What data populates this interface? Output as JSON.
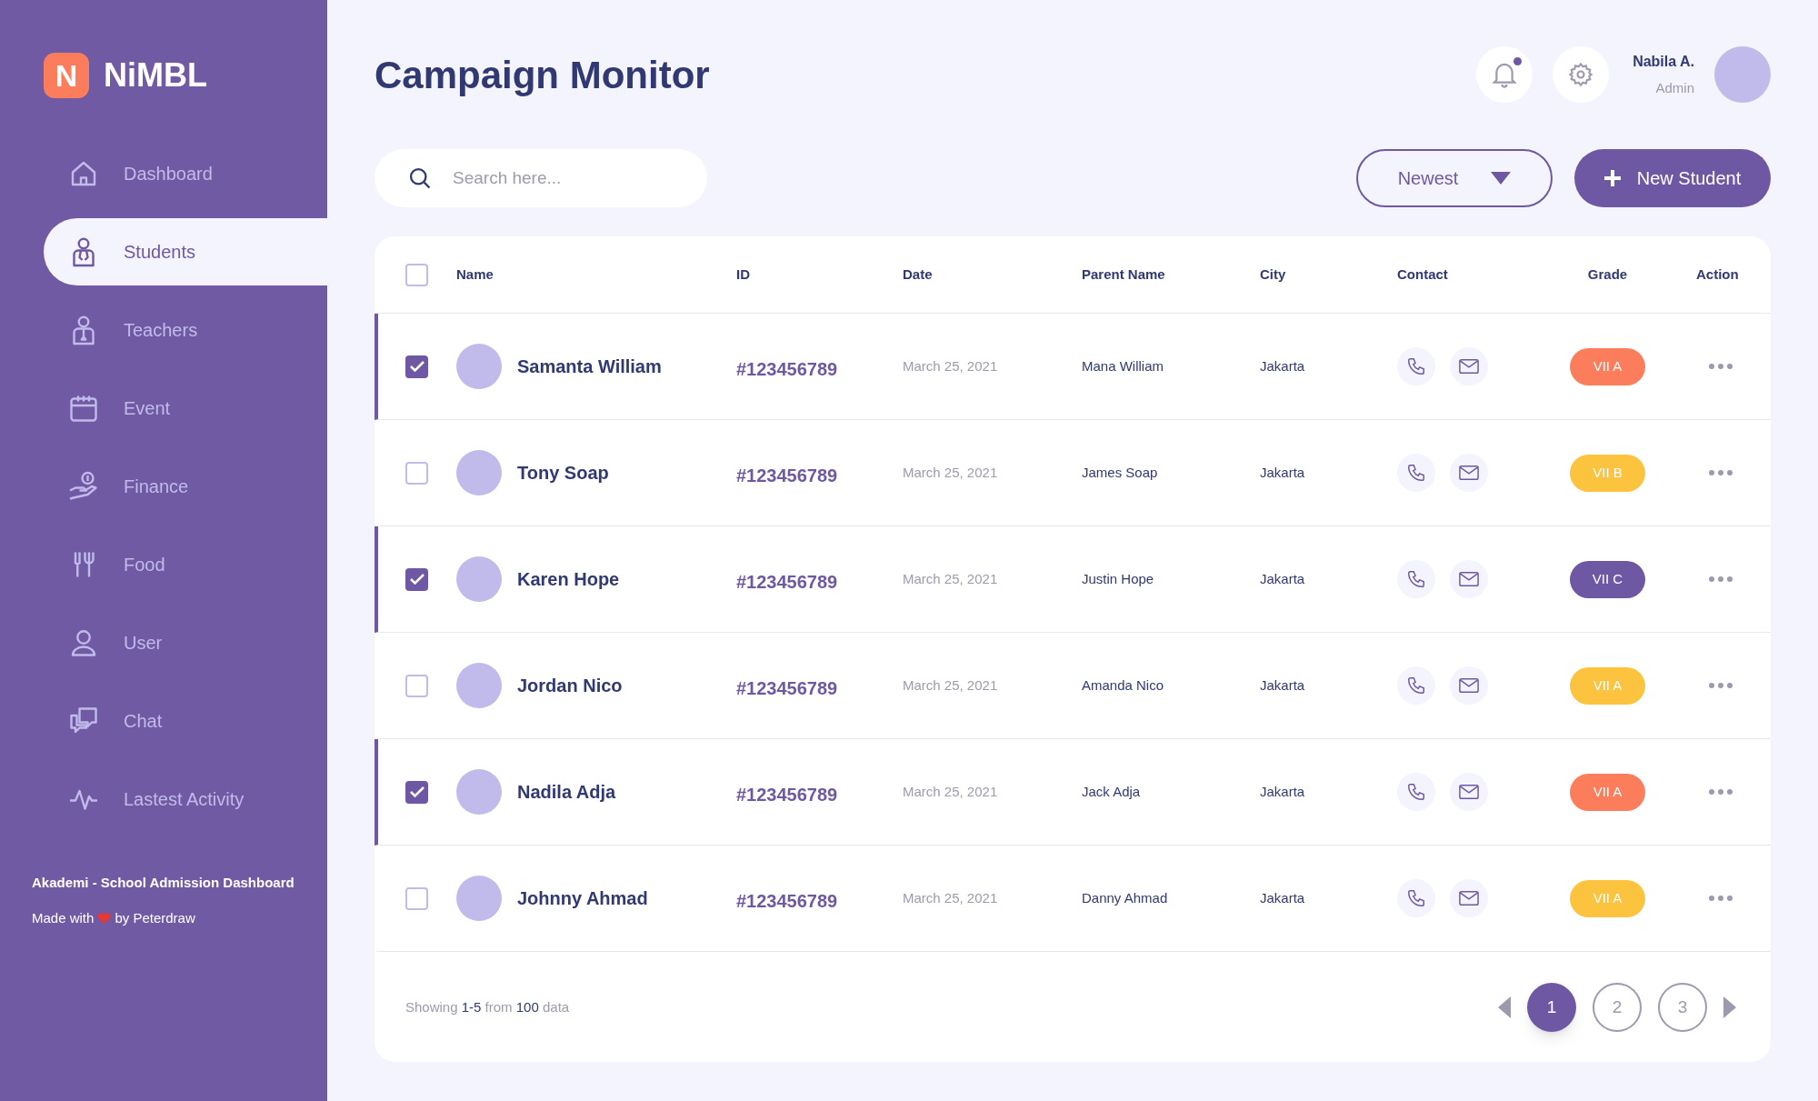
{
  "brand": {
    "logo_letter": "N",
    "name": "NiMBL"
  },
  "sidebar": {
    "items": [
      {
        "label": "Dashboard",
        "selected": false
      },
      {
        "label": "Students",
        "selected": true
      },
      {
        "label": "Teachers",
        "selected": false
      },
      {
        "label": "Event",
        "selected": false
      },
      {
        "label": "Finance",
        "selected": false
      },
      {
        "label": "Food",
        "selected": false
      },
      {
        "label": "User",
        "selected": false
      },
      {
        "label": "Chat",
        "selected": false
      },
      {
        "label": "Lastest Activity",
        "selected": false
      }
    ],
    "footer_title": "Akademi - School Admission Dashboard",
    "footer_made": "Made with",
    "footer_by": "by Peterdraw"
  },
  "header": {
    "title": "Campaign Monitor",
    "notification_dot": true,
    "user_name": "Nabila A.",
    "user_role": "Admin"
  },
  "toolbar": {
    "search_placeholder": "Search here...",
    "sort": "Newest",
    "new_button": "New Student"
  },
  "table": {
    "select_all_checked": false,
    "columns": [
      "Name",
      "ID",
      "Date",
      "Parent Name",
      "City",
      "Contact",
      "Grade",
      "Action"
    ],
    "rows": [
      {
        "checked": true,
        "name": "Samanta William",
        "id": "#123456789",
        "date": "March 25, 2021",
        "parent": "Mana William",
        "city": "Jakarta",
        "grade": "VII A",
        "color": "#fb7d5b"
      },
      {
        "checked": false,
        "name": "Tony Soap",
        "id": "#123456789",
        "date": "March 25, 2021",
        "parent": "James Soap",
        "city": "Jakarta",
        "grade": "VII B",
        "color": "#fcc43e"
      },
      {
        "checked": true,
        "name": "Karen Hope",
        "id": "#123456789",
        "date": "March 25, 2021",
        "parent": "Justin Hope",
        "city": "Jakarta",
        "grade": "VII C",
        "color": "#6f58a3"
      },
      {
        "checked": false,
        "name": "Jordan Nico",
        "id": "#123456789",
        "date": "March 25, 2021",
        "parent": "Amanda Nico",
        "city": "Jakarta",
        "grade": "VII A",
        "color": "#fcc43e"
      },
      {
        "checked": true,
        "name": "Nadila Adja",
        "id": "#123456789",
        "date": "March 25, 2021",
        "parent": "Jack Adja",
        "city": "Jakarta",
        "grade": "VII A",
        "color": "#fb7d5b"
      },
      {
        "checked": false,
        "name": "Johnny Ahmad",
        "id": "#123456789",
        "date": "March 25, 2021",
        "parent": "Danny Ahmad",
        "city": "Jakarta",
        "grade": "VII A",
        "color": "#fcc43e"
      }
    ],
    "summary": "Showing **1-5** from **100** data",
    "pages": [
      {
        "label": "1",
        "selected": true
      },
      {
        "label": "2",
        "selected": false
      },
      {
        "label": "3",
        "selected": false
      }
    ]
  }
}
